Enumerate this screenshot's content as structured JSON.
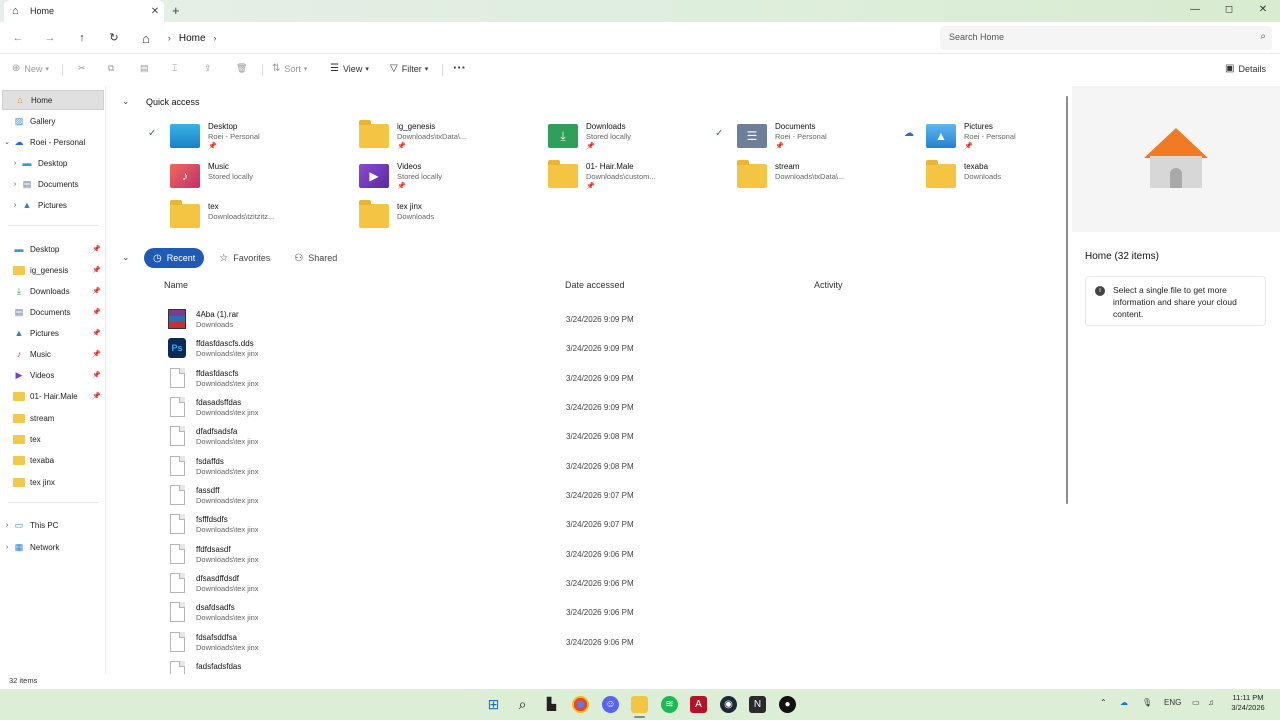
{
  "window": {
    "tab_title": "Home",
    "close_tab": "✕",
    "new_tab": "+",
    "minimize": "—",
    "maximize": "◻",
    "close": "✕"
  },
  "address": {
    "crumbs": [
      "Home"
    ],
    "search_placeholder": "Search Home"
  },
  "toolbar": {
    "new_label": "New",
    "sort_label": "Sort",
    "view_label": "View",
    "filter_label": "Filter",
    "more_label": "···",
    "details_label": "Details"
  },
  "sidebar": {
    "top": [
      {
        "label": "Home",
        "icon": "home-icon"
      },
      {
        "label": "Gallery",
        "icon": "gallery-icon"
      },
      {
        "label": "Roei - Personal",
        "icon": "onedrive-icon"
      },
      {
        "label": "Desktop",
        "icon": "desktop-icon"
      },
      {
        "label": "Documents",
        "icon": "documents-icon"
      },
      {
        "label": "Pictures",
        "icon": "pictures-icon"
      }
    ],
    "pinned": [
      {
        "label": "Desktop",
        "icon": "desktop-icon"
      },
      {
        "label": "ig_genesis",
        "icon": "folder-icon"
      },
      {
        "label": "Downloads",
        "icon": "downloads-icon"
      },
      {
        "label": "Documents",
        "icon": "documents-icon"
      },
      {
        "label": "Pictures",
        "icon": "pictures-icon"
      },
      {
        "label": "Music",
        "icon": "music-icon"
      },
      {
        "label": "Videos",
        "icon": "videos-icon"
      },
      {
        "label": "01- Hair.Male",
        "icon": "folder-icon"
      },
      {
        "label": "stream",
        "icon": "folder-icon"
      },
      {
        "label": "tex",
        "icon": "folder-icon"
      },
      {
        "label": "texaba",
        "icon": "folder-icon"
      },
      {
        "label": "tex jinx",
        "icon": "folder-icon"
      }
    ],
    "bottom": [
      {
        "label": "This PC",
        "icon": "pc-icon"
      },
      {
        "label": "Network",
        "icon": "network-icon"
      }
    ]
  },
  "quick_access": {
    "title": "Quick access",
    "items": [
      {
        "name": "Desktop",
        "sub": "Roei - Personal",
        "icon": "desktop-icon"
      },
      {
        "name": "ig_genesis",
        "sub": "Downloads\\txData\\...",
        "icon": "folder-icon"
      },
      {
        "name": "Downloads",
        "sub": "Stored locally",
        "icon": "downloads-icon"
      },
      {
        "name": "Documents",
        "sub": "Roei - Personal",
        "icon": "documents-icon"
      },
      {
        "name": "Pictures",
        "sub": "Roei - Personal",
        "icon": "pictures-icon"
      },
      {
        "name": "Music",
        "sub": "Stored locally",
        "icon": "music-icon"
      },
      {
        "name": "Videos",
        "sub": "Stored locally",
        "icon": "videos-icon"
      },
      {
        "name": "01- Hair.Male",
        "sub": "Downloads\\custom...",
        "icon": "folder-icon"
      },
      {
        "name": "stream",
        "sub": "Downloads\\txData\\...",
        "icon": "folder-icon"
      },
      {
        "name": "texaba",
        "sub": "Downloads",
        "icon": "folder-icon"
      },
      {
        "name": "tex",
        "sub": "Downloads\\tzitzitz...",
        "icon": "folder-icon"
      },
      {
        "name": "tex jinx",
        "sub": "Downloads",
        "icon": "folder-icon"
      }
    ]
  },
  "filters": {
    "recent": "Recent",
    "favorites": "Favorites",
    "shared": "Shared"
  },
  "columns": {
    "name": "Name",
    "date": "Date accessed",
    "activity": "Activity"
  },
  "files": [
    {
      "name": "4Aba (1).rar",
      "location": "Downloads",
      "date": "3/24/2026 9:09 PM",
      "icon": "rar-icon"
    },
    {
      "name": "ffdasfdascfs.dds",
      "location": "Downloads\\tex jinx",
      "date": "3/24/2026 9:09 PM",
      "icon": "photoshop-icon"
    },
    {
      "name": "ffdasfdascfs",
      "location": "Downloads\\tex jinx",
      "date": "3/24/2026 9:09 PM",
      "icon": "file-icon"
    },
    {
      "name": "fdasadsffdas",
      "location": "Downloads\\tex jinx",
      "date": "3/24/2026 9:09 PM",
      "icon": "file-icon"
    },
    {
      "name": "dfadfsadsfa",
      "location": "Downloads\\tex jinx",
      "date": "3/24/2026 9:08 PM",
      "icon": "file-icon"
    },
    {
      "name": "fsdaffds",
      "location": "Downloads\\tex jinx",
      "date": "3/24/2026 9:08 PM",
      "icon": "file-icon"
    },
    {
      "name": "fassdff",
      "location": "Downloads\\tex jinx",
      "date": "3/24/2026 9:07 PM",
      "icon": "file-icon"
    },
    {
      "name": "fsfffdsdfs",
      "location": "Downloads\\tex jinx",
      "date": "3/24/2026 9:07 PM",
      "icon": "file-icon"
    },
    {
      "name": "ffdfdsasdf",
      "location": "Downloads\\tex jinx",
      "date": "3/24/2026 9:06 PM",
      "icon": "file-icon"
    },
    {
      "name": "dfsasdffdsdf",
      "location": "Downloads\\tex jinx",
      "date": "3/24/2026 9:06 PM",
      "icon": "file-icon"
    },
    {
      "name": "dsafdsadfs",
      "location": "Downloads\\tex jinx",
      "date": "3/24/2026 9:06 PM",
      "icon": "file-icon"
    },
    {
      "name": "fdsafsddfsa",
      "location": "Downloads\\tex jinx",
      "date": "3/24/2026 9:06 PM",
      "icon": "file-icon"
    },
    {
      "name": "fadsfadsfdas",
      "location": "",
      "date": "",
      "icon": "file-icon"
    }
  ],
  "details": {
    "title": "Home (32 items)",
    "info": "Select a single file to get more information and share your cloud content."
  },
  "status": {
    "items": "32 items"
  },
  "tray": {
    "language": "ENG",
    "time": "11:11 PM",
    "date": "3/24/2026"
  },
  "colors": {
    "accent": "#1f5bb5",
    "folder": "#f4c542",
    "taskbar": "#dcefd6"
  }
}
